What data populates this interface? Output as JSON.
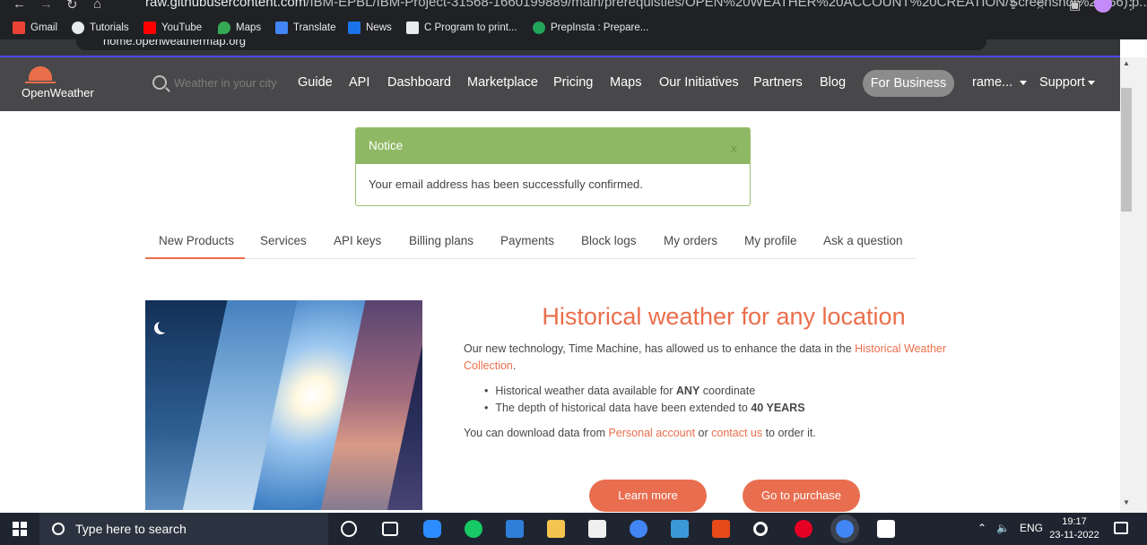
{
  "browser": {
    "url_host": "raw.githubusercontent.com",
    "url_path": "/IBM-EPBL/IBM-Project-31568-1660199889/main/prerequisties/OPEN%20WEATHER%20ACCOUNT%20CREATION/Screenshot%20(56).p...",
    "inner_url": "home.openweathermap.org",
    "bookmarks": [
      "Gmail",
      "Tutorials",
      "YouTube",
      "Maps",
      "Translate",
      "News",
      "C Program to print...",
      "PrepInsta : Prepare..."
    ]
  },
  "header": {
    "logo_text": "OpenWeather",
    "search_placeholder": "Weather in your city",
    "nav": [
      "Guide",
      "API",
      "Dashboard",
      "Marketplace",
      "Pricing",
      "Maps",
      "Our Initiatives",
      "Partners",
      "Blog"
    ],
    "for_business": "For Business",
    "user": "rame...",
    "support": "Support"
  },
  "notice": {
    "title": "Notice",
    "close": "x",
    "message": "Your email address has been successfully confirmed."
  },
  "tabs": [
    "New Products",
    "Services",
    "API keys",
    "Billing plans",
    "Payments",
    "Block logs",
    "My orders",
    "My profile",
    "Ask a question"
  ],
  "hero": {
    "title": "Historical weather for any location",
    "intro_prefix": "Our new technology, Time Machine, has allowed us to enhance the data in the ",
    "intro_link": "Historical Weather Collection",
    "intro_suffix": ".",
    "bullet1_prefix": "Historical weather data available for ",
    "bullet1_bold": "ANY",
    "bullet1_suffix": " coordinate",
    "bullet2_prefix": "The depth of historical data have been extended to ",
    "bullet2_bold": "40 YEARS",
    "download_prefix": "You can download data from ",
    "download_link1": "Personal account",
    "download_mid": " or ",
    "download_link2": "contact us",
    "download_suffix": " to order it.",
    "learn_more": "Learn more",
    "go_purchase": "Go to purchase"
  },
  "taskbar": {
    "search_text": "Type here to search",
    "lang": "ENG",
    "time": "19:17",
    "date": "23-11-2022"
  },
  "colors": {
    "accent": "#eb6e4b",
    "header_bg": "#48484a",
    "notice_green": "#8fb864"
  }
}
